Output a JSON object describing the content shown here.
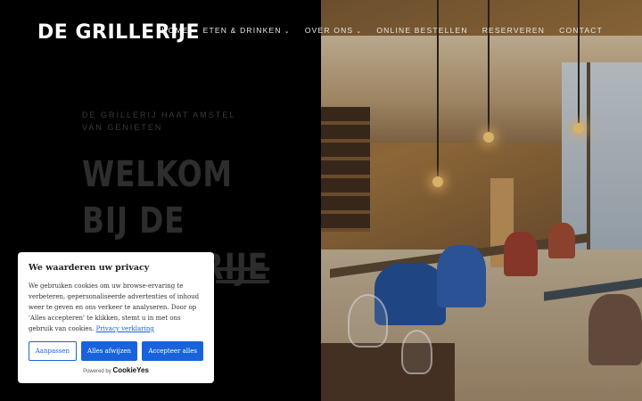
{
  "header": {
    "logo": "DE GRILLERIJE",
    "nav": [
      {
        "label": "HOME",
        "active": true,
        "has_dropdown": false
      },
      {
        "label": "ETEN & DRINKEN",
        "active": false,
        "has_dropdown": true
      },
      {
        "label": "OVER ONS",
        "active": false,
        "has_dropdown": true
      },
      {
        "label": "ONLINE BESTELLEN",
        "active": false,
        "has_dropdown": false
      },
      {
        "label": "RESERVEREN",
        "active": false,
        "has_dropdown": false
      },
      {
        "label": "CONTACT",
        "active": false,
        "has_dropdown": false
      }
    ]
  },
  "hero": {
    "eyebrow": "DE GRILLERIJ HAAT AMSTEL VAN GENIETEN",
    "title": "WELKOM BIJ DE GRILLERIJE"
  },
  "cookie": {
    "title": "We waarderen uw privacy",
    "text": "We gebruiken cookies om uw browse-ervaring te verbeteren, gepersonaliseerde advertenties of inhoud weer te geven en ons verkeer te analyseren. Door op 'Alles accepteren' te klikken, stemt u in met ons gebruik van cookies.",
    "link": "Privacy verklaring",
    "buttons": {
      "customize": "Aanpassen",
      "reject": "Alles afwijzen",
      "accept": "Accepteer alles"
    },
    "powered_by": "Powered by",
    "brand": "CookieYes"
  },
  "colors": {
    "accent": "#1863dc",
    "background": "#000000"
  }
}
